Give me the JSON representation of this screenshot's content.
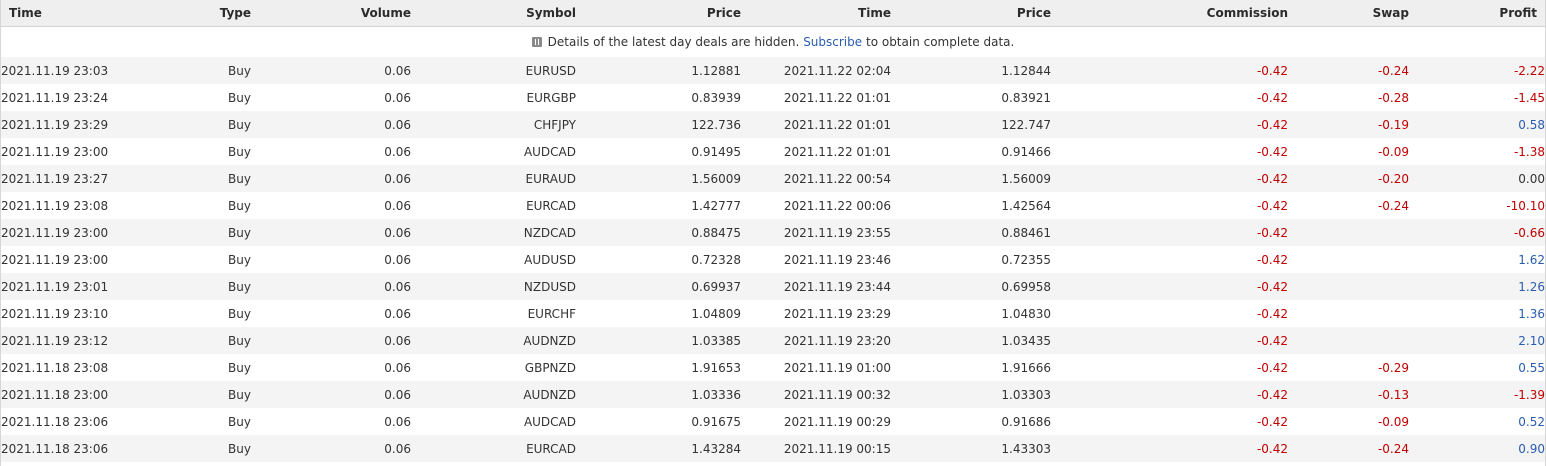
{
  "headers": [
    "Time",
    "Type",
    "Volume",
    "Symbol",
    "Price",
    "Time",
    "Price",
    "Commission",
    "Swap",
    "Profit"
  ],
  "notice": {
    "text_before": "Details of the latest day deals are hidden.",
    "link": "Subscribe",
    "text_after": "to obtain complete data."
  },
  "rows": [
    {
      "open_time": "2021.11.19 23:03",
      "type": "Buy",
      "volume": "0.06",
      "symbol": "EURUSD",
      "open_price": "1.12881",
      "close_time": "2021.11.22 02:04",
      "close_price": "1.12844",
      "commission": "-0.42",
      "swap": "-0.24",
      "profit": "-2.22"
    },
    {
      "open_time": "2021.11.19 23:24",
      "type": "Buy",
      "volume": "0.06",
      "symbol": "EURGBP",
      "open_price": "0.83939",
      "close_time": "2021.11.22 01:01",
      "close_price": "0.83921",
      "commission": "-0.42",
      "swap": "-0.28",
      "profit": "-1.45"
    },
    {
      "open_time": "2021.11.19 23:29",
      "type": "Buy",
      "volume": "0.06",
      "symbol": "CHFJPY",
      "open_price": "122.736",
      "close_time": "2021.11.22 01:01",
      "close_price": "122.747",
      "commission": "-0.42",
      "swap": "-0.19",
      "profit": "0.58"
    },
    {
      "open_time": "2021.11.19 23:00",
      "type": "Buy",
      "volume": "0.06",
      "symbol": "AUDCAD",
      "open_price": "0.91495",
      "close_time": "2021.11.22 01:01",
      "close_price": "0.91466",
      "commission": "-0.42",
      "swap": "-0.09",
      "profit": "-1.38"
    },
    {
      "open_time": "2021.11.19 23:27",
      "type": "Buy",
      "volume": "0.06",
      "symbol": "EURAUD",
      "open_price": "1.56009",
      "close_time": "2021.11.22 00:54",
      "close_price": "1.56009",
      "commission": "-0.42",
      "swap": "-0.20",
      "profit": "0.00"
    },
    {
      "open_time": "2021.11.19 23:08",
      "type": "Buy",
      "volume": "0.06",
      "symbol": "EURCAD",
      "open_price": "1.42777",
      "close_time": "2021.11.22 00:06",
      "close_price": "1.42564",
      "commission": "-0.42",
      "swap": "-0.24",
      "profit": "-10.10"
    },
    {
      "open_time": "2021.11.19 23:00",
      "type": "Buy",
      "volume": "0.06",
      "symbol": "NZDCAD",
      "open_price": "0.88475",
      "close_time": "2021.11.19 23:55",
      "close_price": "0.88461",
      "commission": "-0.42",
      "swap": "",
      "profit": "-0.66"
    },
    {
      "open_time": "2021.11.19 23:00",
      "type": "Buy",
      "volume": "0.06",
      "symbol": "AUDUSD",
      "open_price": "0.72328",
      "close_time": "2021.11.19 23:46",
      "close_price": "0.72355",
      "commission": "-0.42",
      "swap": "",
      "profit": "1.62"
    },
    {
      "open_time": "2021.11.19 23:01",
      "type": "Buy",
      "volume": "0.06",
      "symbol": "NZDUSD",
      "open_price": "0.69937",
      "close_time": "2021.11.19 23:44",
      "close_price": "0.69958",
      "commission": "-0.42",
      "swap": "",
      "profit": "1.26"
    },
    {
      "open_time": "2021.11.19 23:10",
      "type": "Buy",
      "volume": "0.06",
      "symbol": "EURCHF",
      "open_price": "1.04809",
      "close_time": "2021.11.19 23:29",
      "close_price": "1.04830",
      "commission": "-0.42",
      "swap": "",
      "profit": "1.36"
    },
    {
      "open_time": "2021.11.19 23:12",
      "type": "Buy",
      "volume": "0.06",
      "symbol": "AUDNZD",
      "open_price": "1.03385",
      "close_time": "2021.11.19 23:20",
      "close_price": "1.03435",
      "commission": "-0.42",
      "swap": "",
      "profit": "2.10"
    },
    {
      "open_time": "2021.11.18 23:08",
      "type": "Buy",
      "volume": "0.06",
      "symbol": "GBPNZD",
      "open_price": "1.91653",
      "close_time": "2021.11.19 01:00",
      "close_price": "1.91666",
      "commission": "-0.42",
      "swap": "-0.29",
      "profit": "0.55"
    },
    {
      "open_time": "2021.11.18 23:00",
      "type": "Buy",
      "volume": "0.06",
      "symbol": "AUDNZD",
      "open_price": "1.03336",
      "close_time": "2021.11.19 00:32",
      "close_price": "1.03303",
      "commission": "-0.42",
      "swap": "-0.13",
      "profit": "-1.39"
    },
    {
      "open_time": "2021.11.18 23:06",
      "type": "Buy",
      "volume": "0.06",
      "symbol": "AUDCAD",
      "open_price": "0.91675",
      "close_time": "2021.11.19 00:29",
      "close_price": "0.91686",
      "commission": "-0.42",
      "swap": "-0.09",
      "profit": "0.52"
    },
    {
      "open_time": "2021.11.18 23:06",
      "type": "Buy",
      "volume": "0.06",
      "symbol": "EURCAD",
      "open_price": "1.43284",
      "close_time": "2021.11.19 00:15",
      "close_price": "1.43303",
      "commission": "-0.42",
      "swap": "-0.24",
      "profit": "0.90"
    }
  ]
}
